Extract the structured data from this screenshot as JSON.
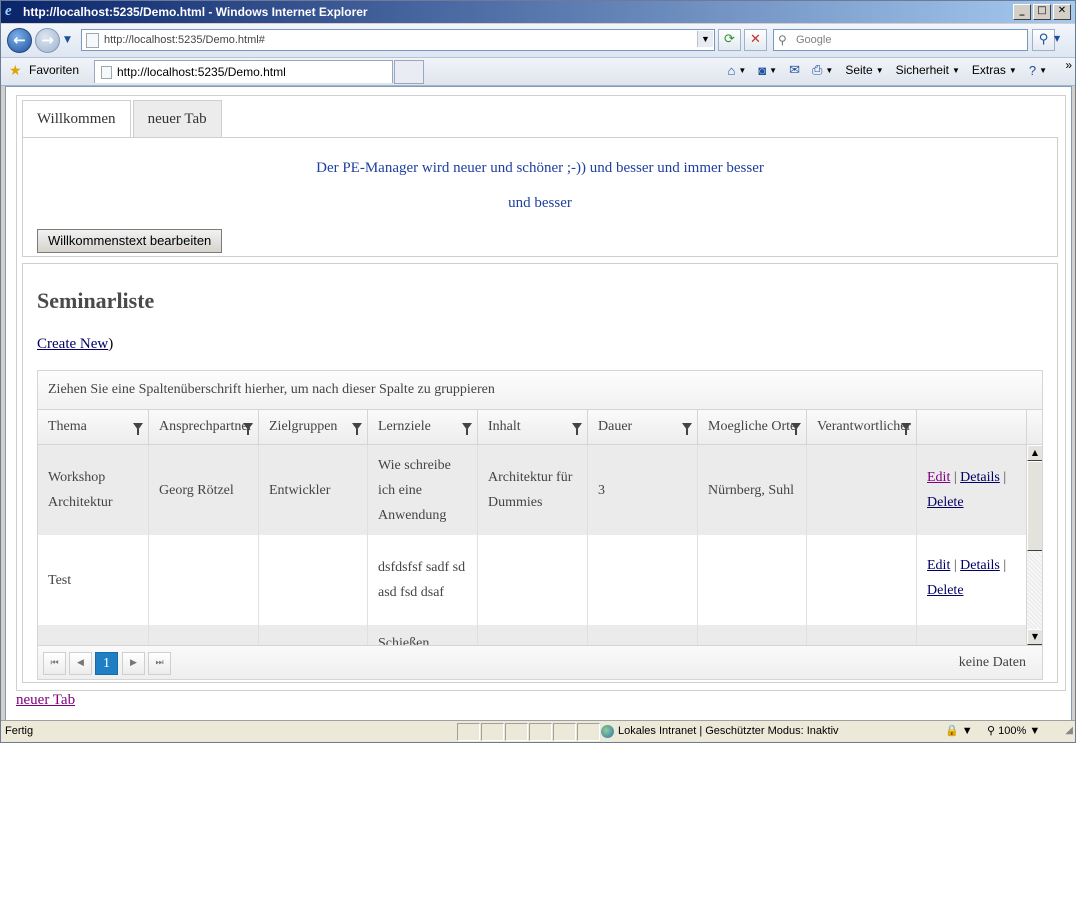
{
  "window": {
    "title": "http://localhost:5235/Demo.html - Windows Internet Explorer",
    "minimize": "_",
    "maximize": "□",
    "close": "✕"
  },
  "navbar": {
    "address": "http://localhost:5235/Demo.html#",
    "search_placeholder": "Google"
  },
  "favbar": {
    "favorites_label": "Favoriten",
    "tab_title": "http://localhost:5235/Demo.html",
    "commands": [
      "Seite",
      "Sicherheit",
      "Extras"
    ],
    "overflow": "»"
  },
  "tabs": [
    {
      "label": "Willkommen",
      "active": true
    },
    {
      "label": "neuer Tab",
      "active": false
    }
  ],
  "welcome": {
    "line1": "Der PE-Manager wird neuer und schöner ;-)) und besser und immer besser",
    "line2": "und besser",
    "edit_button": "Willkommenstext bearbeiten"
  },
  "seminar": {
    "title": "Seminarliste",
    "create_new": "Create New",
    "create_new_suffix": ")"
  },
  "grid": {
    "grouping_hint": "Ziehen Sie eine Spaltenüberschrift hierher, um nach dieser Spalte zu gruppieren",
    "columns": [
      "Thema",
      "Ansprechpartner",
      "Zielgruppen",
      "Lernziele",
      "Inhalt",
      "Dauer",
      "Moegliche Orte",
      "Verantwortlicher",
      ""
    ],
    "rows": [
      {
        "thema": "Workshop Architektur",
        "ansprechpartner": "Georg Rötzel",
        "zielgruppen": "Entwickler",
        "lernziele": "Wie schreibe ich eine Anwendung",
        "inhalt": "Architektur für Dummies",
        "dauer": "3",
        "orte": "Nürnberg, Suhl",
        "verantwortlicher": ""
      },
      {
        "thema": "Test",
        "ansprechpartner": "",
        "zielgruppen": "",
        "lernziele": "dsfdsfsf sadf sd asd fsd dsaf",
        "inhalt": "",
        "dauer": "",
        "orte": "",
        "verantwortlicher": ""
      },
      {
        "thema": "",
        "ansprechpartner": "",
        "zielgruppen": "",
        "lernziele": "Schießen",
        "inhalt": "",
        "dauer": "",
        "orte": "",
        "verantwortlicher": ""
      }
    ],
    "actions": {
      "edit": "Edit",
      "details": "Details",
      "delete": "Delete",
      "sep": "|"
    },
    "pager": {
      "current_page": "1",
      "info": "keine Daten"
    }
  },
  "bottom_link": "neuer Tab",
  "statusbar": {
    "text": "Fertig",
    "zone": "Lokales Intranet | Geschützter Modus: Inaktiv",
    "zoom": "100%"
  }
}
